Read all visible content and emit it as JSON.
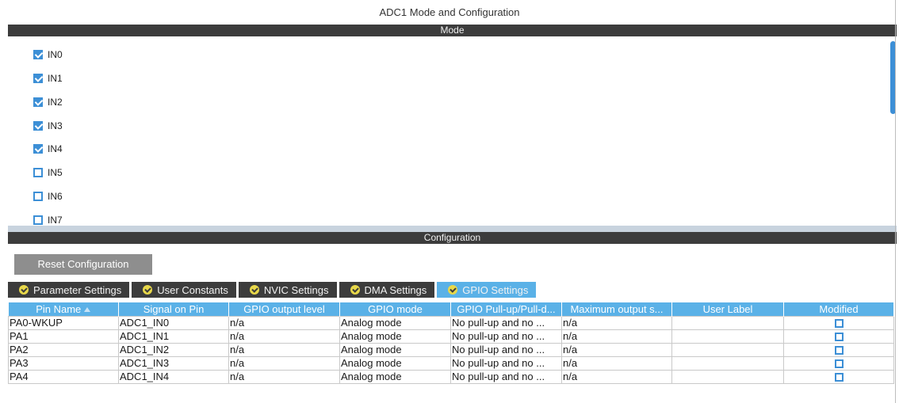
{
  "title": "ADC1 Mode and Configuration",
  "mode": {
    "header": "Mode",
    "channels": [
      {
        "label": "IN0",
        "checked": true
      },
      {
        "label": "IN1",
        "checked": true
      },
      {
        "label": "IN2",
        "checked": true
      },
      {
        "label": "IN3",
        "checked": true
      },
      {
        "label": "IN4",
        "checked": true
      },
      {
        "label": "IN5",
        "checked": false
      },
      {
        "label": "IN6",
        "checked": false
      },
      {
        "label": "IN7",
        "checked": false
      }
    ]
  },
  "configuration": {
    "header": "Configuration",
    "reset_label": "Reset Configuration",
    "tabs": [
      {
        "label": "Parameter Settings",
        "active": false
      },
      {
        "label": "User Constants",
        "active": false
      },
      {
        "label": "NVIC Settings",
        "active": false
      },
      {
        "label": "DMA Settings",
        "active": false
      },
      {
        "label": "GPIO Settings",
        "active": true
      }
    ],
    "table": {
      "columns": [
        "Pin Name",
        "Signal on Pin",
        "GPIO output level",
        "GPIO mode",
        "GPIO Pull-up/Pull-d...",
        "Maximum output s...",
        "User Label",
        "Modified"
      ],
      "rows": [
        [
          "PA0-WKUP",
          "ADC1_IN0",
          "n/a",
          "Analog mode",
          "No pull-up and no ...",
          "n/a",
          "",
          false
        ],
        [
          "PA1",
          "ADC1_IN1",
          "n/a",
          "Analog mode",
          "No pull-up and no ...",
          "n/a",
          "",
          false
        ],
        [
          "PA2",
          "ADC1_IN2",
          "n/a",
          "Analog mode",
          "No pull-up and no ...",
          "n/a",
          "",
          false
        ],
        [
          "PA3",
          "ADC1_IN3",
          "n/a",
          "Analog mode",
          "No pull-up and no ...",
          "n/a",
          "",
          false
        ],
        [
          "PA4",
          "ADC1_IN4",
          "n/a",
          "Analog mode",
          "No pull-up and no ...",
          "n/a",
          "",
          false
        ]
      ]
    }
  },
  "colors": {
    "accent": "#5ab1e7",
    "checkbox": "#3c8fd6",
    "bar": "#3c3c3c"
  }
}
